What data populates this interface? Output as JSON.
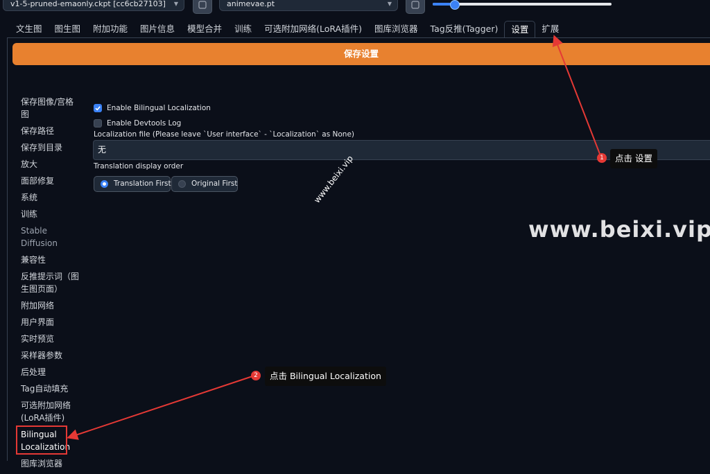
{
  "topbar": {
    "checkpoint": "v1-5-pruned-emaonly.ckpt [cc6cb27103]",
    "vae": "animevae.pt",
    "clip_skip_slider": 0.12
  },
  "tabs": [
    {
      "label": "文生图"
    },
    {
      "label": "图生图"
    },
    {
      "label": "附加功能"
    },
    {
      "label": "图片信息"
    },
    {
      "label": "模型合并"
    },
    {
      "label": "训练"
    },
    {
      "label": "可选附加网络(LoRA插件)"
    },
    {
      "label": "图库浏览器"
    },
    {
      "label": "Tag反推(Tagger)"
    },
    {
      "label": "设置"
    },
    {
      "label": "扩展"
    }
  ],
  "save_button": "保存设置",
  "sidebar": {
    "items": [
      "保存图像/宫格图",
      "保存路径",
      "保存到目录",
      "放大",
      "面部修复",
      "系统",
      "训练",
      "Stable Diffusion",
      "兼容性",
      "反推提示词（图生图页面）",
      "附加网络",
      "用户界面",
      "实时预览",
      "采样器参数",
      "后处理",
      "Tag自动填充",
      "可选附加网络(LoRA插件)",
      "Bilingual Localization",
      "图库浏览器"
    ]
  },
  "settings": {
    "enable_bilingual": "Enable Bilingual Localization",
    "enable_devtools": "Enable Devtools Log",
    "localization_file_label": "Localization file (Please leave `User interface` - `Localization` as None)",
    "localization_file_value": "无",
    "display_order_label": "Translation display order",
    "order_options": [
      "Translation First",
      "Original First"
    ]
  },
  "annotations": {
    "step1_num": "1",
    "step1_text": "点击 设置",
    "step2_num": "2",
    "step2_text": "点击 Bilingual Localization",
    "watermark": "www.beixi.vip",
    "watermark_small": "www.beixi.vip"
  },
  "colors": {
    "accent": "#e8812f",
    "primary": "#3b82f6",
    "annotation": "#e53935"
  }
}
